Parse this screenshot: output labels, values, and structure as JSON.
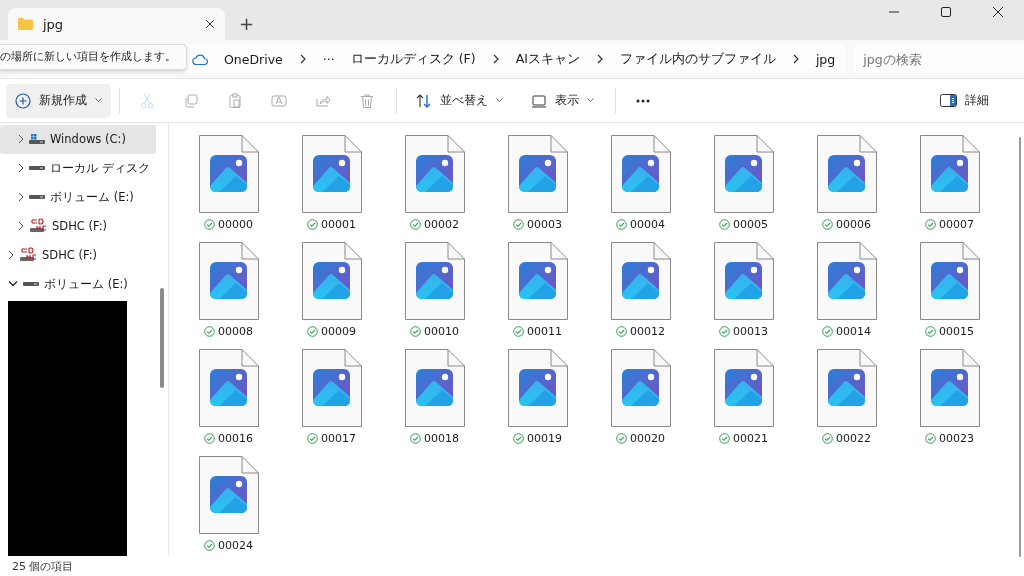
{
  "window": {
    "tab": {
      "title": "jpg",
      "selected": true
    },
    "new_tab": "+"
  },
  "tooltip": "の場所に新しい項目を作成します。",
  "address_bar": {
    "breadcrumbs": [
      "OneDrive",
      "ローカルディスク (F)",
      "AIスキャン",
      "ファイル内のサブファイル",
      "jpg"
    ],
    "overflow": "···"
  },
  "search": {
    "placeholder": "jpgの検索"
  },
  "toolbar": {
    "actions": [
      {
        "kind": "new",
        "label": "新規作成",
        "disabled": false
      },
      {
        "kind": "cut",
        "disabled": true
      },
      {
        "kind": "copy",
        "disabled": true
      },
      {
        "kind": "paste",
        "disabled": true
      },
      {
        "kind": "rename",
        "disabled": true
      },
      {
        "kind": "share",
        "disabled": true
      },
      {
        "kind": "delete",
        "disabled": true
      },
      {
        "kind": "sort",
        "label": "並べ替え",
        "disabled": false
      },
      {
        "kind": "view",
        "label": "表示",
        "disabled": false
      },
      {
        "kind": "more",
        "disabled": false
      }
    ],
    "details": "詳細"
  },
  "sidebar": {
    "nested_items": [
      {
        "label": "Windows (C:)",
        "kind": "windows",
        "selected": true,
        "expanded": false
      },
      {
        "label": "ローカル ディスク",
        "kind": "drive",
        "selected": false,
        "expanded": false
      },
      {
        "label": "ボリューム (E:)",
        "kind": "drive",
        "selected": false,
        "expanded": false
      },
      {
        "label": "SDHC (F:)",
        "kind": "sd",
        "selected": false,
        "expanded": false
      }
    ],
    "items": [
      {
        "label": "SDHC (F:)",
        "kind": "sd",
        "selected": false,
        "expanded": false
      },
      {
        "label": "ボリューム (E:)",
        "kind": "drive",
        "selected": false,
        "expanded": true
      }
    ]
  },
  "files": [
    {
      "name": "00000",
      "synced": true
    },
    {
      "name": "00001",
      "synced": true
    },
    {
      "name": "00002",
      "synced": true
    },
    {
      "name": "00003",
      "synced": true
    },
    {
      "name": "00004",
      "synced": true
    },
    {
      "name": "00005",
      "synced": true
    },
    {
      "name": "00006",
      "synced": true
    },
    {
      "name": "00007",
      "synced": true
    },
    {
      "name": "00008",
      "synced": true
    },
    {
      "name": "00009",
      "synced": true
    },
    {
      "name": "00010",
      "synced": true
    },
    {
      "name": "00011",
      "synced": true
    },
    {
      "name": "00012",
      "synced": true
    },
    {
      "name": "00013",
      "synced": true
    },
    {
      "name": "00014",
      "synced": true
    },
    {
      "name": "00015",
      "synced": true
    },
    {
      "name": "00016",
      "synced": true
    },
    {
      "name": "00017",
      "synced": true
    },
    {
      "name": "00018",
      "synced": true
    },
    {
      "name": "00019",
      "synced": true
    },
    {
      "name": "00020",
      "synced": true
    },
    {
      "name": "00021",
      "synced": true
    },
    {
      "name": "00022",
      "synced": true
    },
    {
      "name": "00023",
      "synced": true
    },
    {
      "name": "00024",
      "synced": true
    }
  ],
  "status_bar": {
    "item_count": "25 個の項目"
  }
}
